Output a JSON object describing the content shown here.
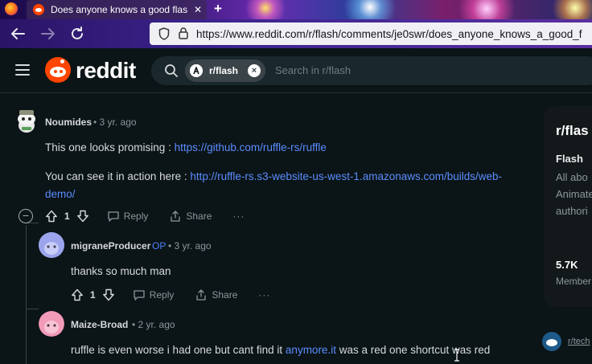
{
  "browser": {
    "tab_title": "Does anyone knows a good flas",
    "tab_close": "✕",
    "new_tab": "+",
    "url": "https://www.reddit.com/r/flash/comments/je0swr/does_anyone_knows_a_good_f"
  },
  "header": {
    "wordmark": "reddit",
    "search_chip": "r/flash",
    "search_chip_close": "×",
    "search_placeholder": "Search in r/flash"
  },
  "comments": [
    {
      "username": "Noumides",
      "meta": "• 3 yr. ago",
      "text_1_prefix": "This one looks promising : ",
      "text_1_link": "https://github.com/ruffle-rs/ruffle",
      "text_2_prefix": "You can see it in action here : ",
      "text_2_link_a": "http://ruffle-rs.s3-website-us-west-1.amazonaws.com/builds/web-",
      "text_2_link_b": "demo/",
      "votes": "1",
      "reply": "Reply",
      "share": "Share",
      "more": "···",
      "collapse": "−"
    },
    {
      "username": "migraneProducer",
      "op": "OP",
      "meta": "• 3 yr. ago",
      "text": "thanks so much man",
      "votes": "1",
      "reply": "Reply",
      "share": "Share",
      "more": "···"
    },
    {
      "username": "Maize-Broad",
      "meta": "• 2 yr. ago",
      "text_prefix": "ruffle is even worse i had one but cant find it ",
      "text_link": "anymore.it",
      "text_suffix": " was a red one shortcut was red"
    }
  ],
  "sidebar": {
    "title": "r/flas",
    "subtitle": "Flash",
    "desc_lines": [
      "All abo",
      "Animate",
      "authori"
    ],
    "members_count": "5.7K",
    "members_label": "Member",
    "related": "r/tech"
  },
  "colors": {
    "accent": "#ff4500",
    "link": "#5a8dff",
    "op": "#4c7fff",
    "background": "#0b1416"
  }
}
